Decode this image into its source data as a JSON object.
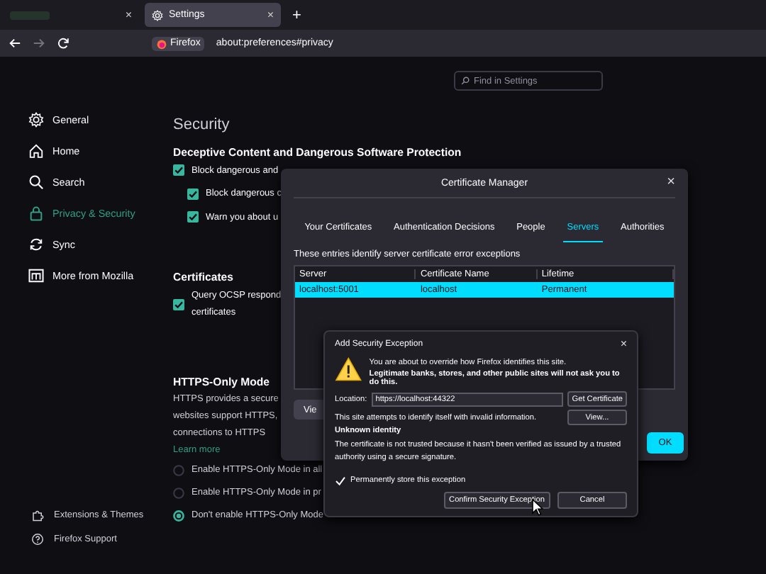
{
  "browser": {
    "tabs": [
      {
        "selected": false,
        "close": "×"
      },
      {
        "title": "Settings",
        "selected": true,
        "close": "×"
      }
    ],
    "new_tab": "+",
    "nav": {
      "forward_disabled": true
    },
    "identity": "Firefox",
    "url": "about:preferences#privacy"
  },
  "search": {
    "placeholder": "Find in Settings"
  },
  "sidebar": {
    "items": [
      {
        "label": "General",
        "selected": false
      },
      {
        "label": "Home",
        "selected": false
      },
      {
        "label": "Search",
        "selected": false
      },
      {
        "label": "Privacy & Security",
        "selected": true
      },
      {
        "label": "Sync",
        "selected": false
      },
      {
        "label": "More from Mozilla",
        "selected": false
      }
    ],
    "footer": [
      {
        "label": "Extensions & Themes"
      },
      {
        "label": "Firefox Support"
      }
    ]
  },
  "security": {
    "title": "Security",
    "heading": "Deceptive Content and Dangerous Software Protection",
    "options": [
      {
        "label": "Block dangerous and",
        "checked": true,
        "children": [
          {
            "label": "Block dangerous c",
            "checked": true
          },
          {
            "label": "Warn you about u",
            "checked": true
          }
        ]
      }
    ]
  },
  "certificates": {
    "heading": "Certificates",
    "options": [
      {
        "label": "Query OCSP respond",
        "label_line_2": "certificates",
        "checked": true
      }
    ]
  },
  "https_only": {
    "heading": "HTTPS-Only Mode",
    "lines": [
      "HTTPS provides a secure",
      "websites support HTTPS,",
      "connections to HTTPS"
    ],
    "link": "Learn more",
    "radios": [
      {
        "label": "Enable HTTPS-Only Mode in all",
        "selected": false
      },
      {
        "label": "Enable HTTPS-Only Mode in pr",
        "selected": false
      },
      {
        "label": "Don't enable HTTPS-Only Mode",
        "selected": true
      }
    ]
  },
  "certificate_manager": {
    "title": "Certificate Manager",
    "close": "×",
    "tabs": [
      {
        "label": "Your Certificates",
        "selected": false
      },
      {
        "label": "Authentication Decisions",
        "selected": false
      },
      {
        "label": "People",
        "selected": false
      },
      {
        "label": "Servers",
        "selected": true
      },
      {
        "label": "Authorities",
        "selected": false
      }
    ],
    "description": "These entries identify server certificate error exceptions",
    "columns": [
      "Server",
      "Certificate Name",
      "Lifetime"
    ],
    "rows": [
      {
        "cells": [
          "localhost:5001",
          "localhost",
          "Permanent"
        ],
        "selected": true
      }
    ],
    "view_button": "Vie",
    "ok_button": "OK"
  },
  "exception_dialog": {
    "title": "Add Security Exception",
    "close": "×",
    "warning": "You are about to override how Firefox identifies this site.",
    "warning_bold": "Legitimate banks, stores, and other public sites will not ask you to do this.",
    "location_label": "Location:",
    "location_value": "https://localhost:44322",
    "get_certificate": "Get Certificate",
    "status": "This site attempts to identify itself with invalid information.",
    "view_button": "View...",
    "identity_heading": "Unknown identity",
    "identity_detail": "The certificate is not trusted because it hasn't been verified as issued by a trusted authority using a secure signature.",
    "permanent": {
      "label": "Permanently store this exception",
      "checked": true
    },
    "confirm_button": "Confirm Security Exception",
    "cancel_button": "Cancel"
  }
}
